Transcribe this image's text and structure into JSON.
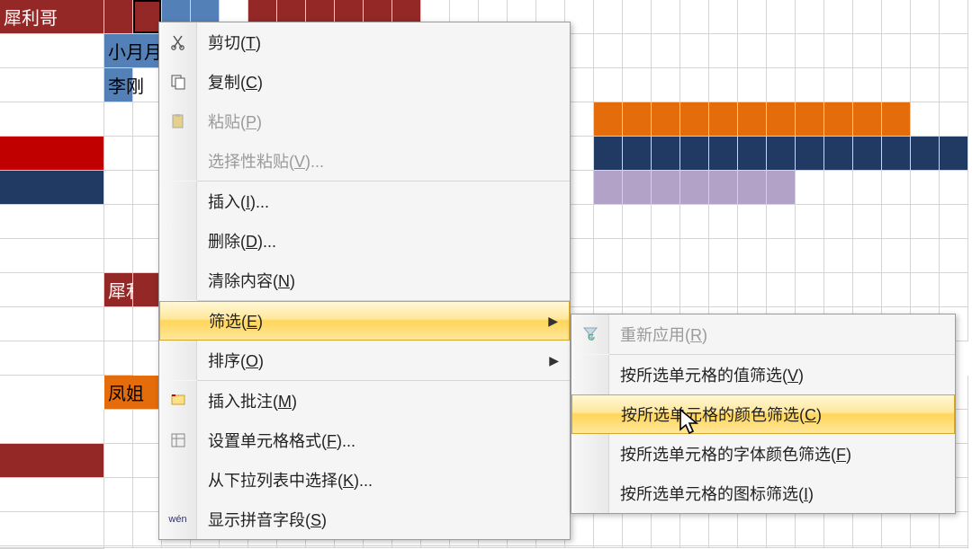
{
  "cells": {
    "A1": "犀利哥",
    "A3": "李刚",
    "A9": "犀利哥",
    "B2": "小月月",
    "B11": "凤姐"
  },
  "menu": {
    "cut": "剪切(T)",
    "copy": "复制(C)",
    "paste": "粘贴(P)",
    "paste_spec": "选择性粘贴(V)...",
    "insert": "插入(I)...",
    "delete": "删除(D)...",
    "clear": "清除内容(N)",
    "filter": "筛选(E)",
    "sort": "排序(O)",
    "comment": "插入批注(M)",
    "format": "设置单元格格式(F)...",
    "dropdown": "从下拉列表中选择(K)...",
    "pinyin": "显示拼音字段(S)"
  },
  "submenu": {
    "reapply": "重新应用(R)",
    "by_value": "按所选单元格的值筛选(V)",
    "by_color": "按所选单元格的颜色筛选(C)",
    "by_fontcolor": "按所选单元格的字体颜色筛选(F)",
    "by_icon": "按所选单元格的图标筛选(I)"
  }
}
